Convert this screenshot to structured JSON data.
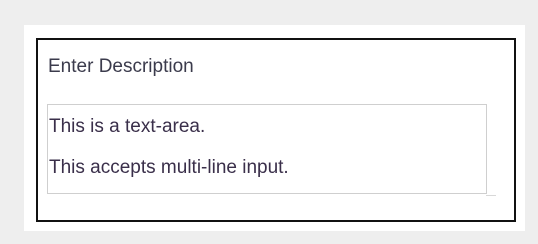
{
  "form": {
    "label": "Enter Description",
    "textarea": {
      "lines": [
        "This is a text-area.",
        "This accepts multi-line input."
      ]
    }
  },
  "colors": {
    "background": "#eeeeee",
    "panel_border": "#111111",
    "textarea_border": "#cfcfcf",
    "text": "#3a2f4a"
  }
}
